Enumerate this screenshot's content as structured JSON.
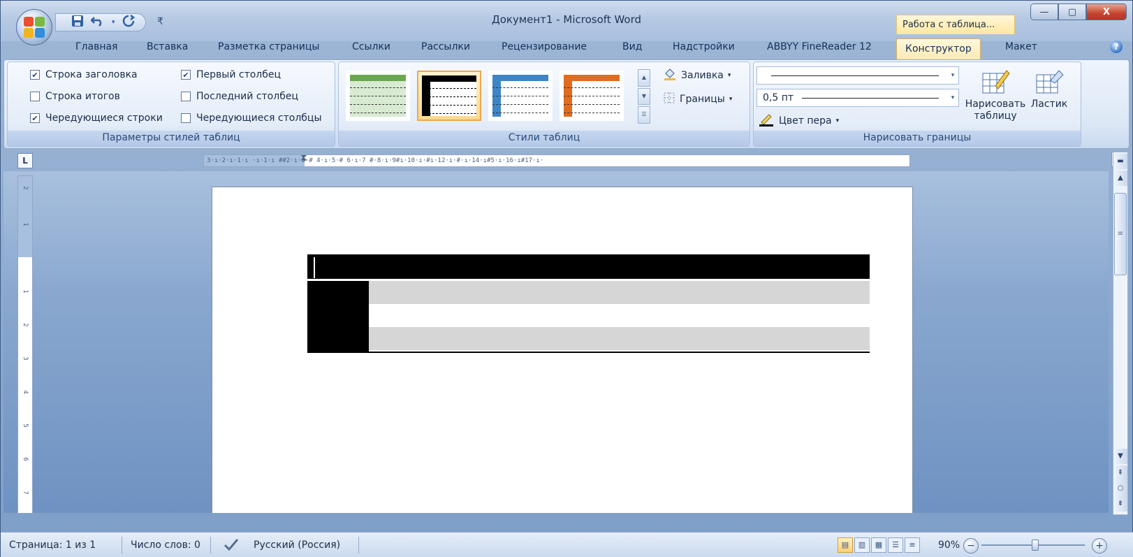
{
  "window": {
    "title": "Документ1 - Microsoft Word",
    "context_tab_group": "Работа с таблица...",
    "controls": {
      "minimize": "—",
      "maximize": "▢",
      "close": "X"
    }
  },
  "qat": {
    "save_icon": "save-icon",
    "undo_icon": "undo-icon",
    "redo_icon": "redo-icon",
    "customize": "₹"
  },
  "tabs": [
    {
      "label": "Главная"
    },
    {
      "label": "Вставка"
    },
    {
      "label": "Разметка страницы"
    },
    {
      "label": "Ссылки"
    },
    {
      "label": "Рассылки"
    },
    {
      "label": "Рецензирование"
    },
    {
      "label": "Вид"
    },
    {
      "label": "Надстройки"
    },
    {
      "label": "ABBYY FineReader 12"
    },
    {
      "label": "Конструктор",
      "active": true
    },
    {
      "label": "Макет"
    }
  ],
  "ribbon": {
    "style_options": {
      "label": "Параметры стилей таблиц",
      "header_row": {
        "label": "Строка заголовка",
        "checked": true
      },
      "total_row": {
        "label": "Строка итогов",
        "checked": false
      },
      "banded_rows": {
        "label": "Чередующиеся строки",
        "checked": true
      },
      "first_column": {
        "label": "Первый столбец",
        "checked": true
      },
      "last_column": {
        "label": "Последний столбец",
        "checked": false
      },
      "banded_columns": {
        "label": "Чередующиеся столбцы",
        "checked": false
      }
    },
    "table_styles": {
      "label": "Стили таблиц",
      "shading": "Заливка",
      "borders": "Границы",
      "thumb_colors": [
        "#6aa84f",
        "#000000",
        "#3d85c6",
        "#e06c1f"
      ]
    },
    "draw_borders": {
      "label": "Нарисовать границы",
      "pen_weight": "0,5 пт",
      "pen_color": "Цвет пера",
      "draw_table_line1": "Нарисовать",
      "draw_table_line2": "таблицу",
      "eraser": "Ластик"
    }
  },
  "ruler": {
    "corner": "L",
    "h_ticks": "3·ı·2·ı·1·ı  ·ı·1·ı ##2·ı·3·# 4·ı·5·# 6·ı·7 #·8·ı·9#ı·10·ı·#ı·12·ı·#·ı·14·ı#5·ı·16·ı#17·ı·",
    "v_ticks": [
      "2",
      "1",
      "1",
      "2",
      "3",
      "4",
      "5",
      "6",
      "7"
    ]
  },
  "status": {
    "page": "Страница: 1 из 1",
    "words": "Число слов: 0",
    "language": "Русский (Россия)",
    "zoom": "90%"
  }
}
